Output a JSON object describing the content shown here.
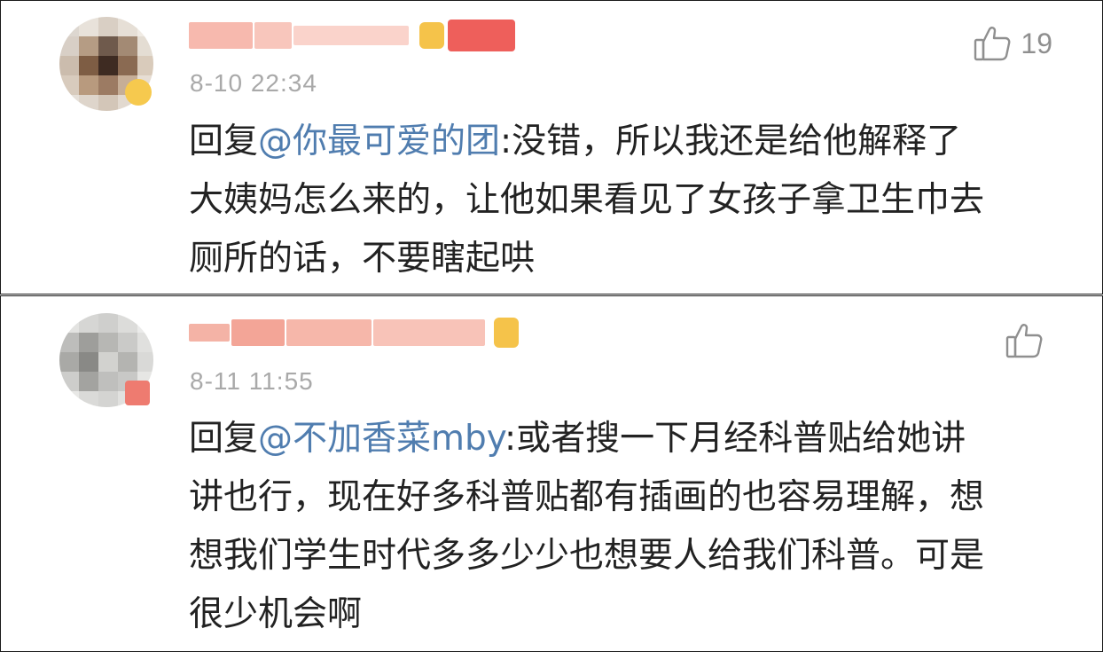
{
  "comments": [
    {
      "timestamp": "8-10 22:34",
      "likes": "19",
      "reply_prefix": "回复",
      "mention": "@你最可爱的团",
      "body_lines": [
        ":没错，所以我还是给他解释了",
        "大姨妈怎么来的，让他如果看见了女孩子拿卫生巾去",
        "厕所的话，不要瞎起哄"
      ],
      "name_color": "#f4a79b",
      "badge_colors": [
        "#f5c34a",
        "#ee5f5b"
      ]
    },
    {
      "timestamp": "8-11 11:55",
      "likes": "",
      "reply_prefix": "回复",
      "mention": "@不加香菜mby",
      "body_lines": [
        ":或者搜一下月经科普贴给她讲",
        "讲也行，现在好多科普贴都有插画的也容易理解，想",
        "想我们学生时代多多少少也想要人给我们科普。可是",
        "很少机会啊"
      ],
      "name_color": "#f2a090",
      "badge_colors": [
        "#f5c34a"
      ]
    }
  ],
  "icons": {
    "like": "thumbs-up-icon",
    "accent_mention": "#507daf",
    "timestamp_color": "#a9a9a9"
  }
}
